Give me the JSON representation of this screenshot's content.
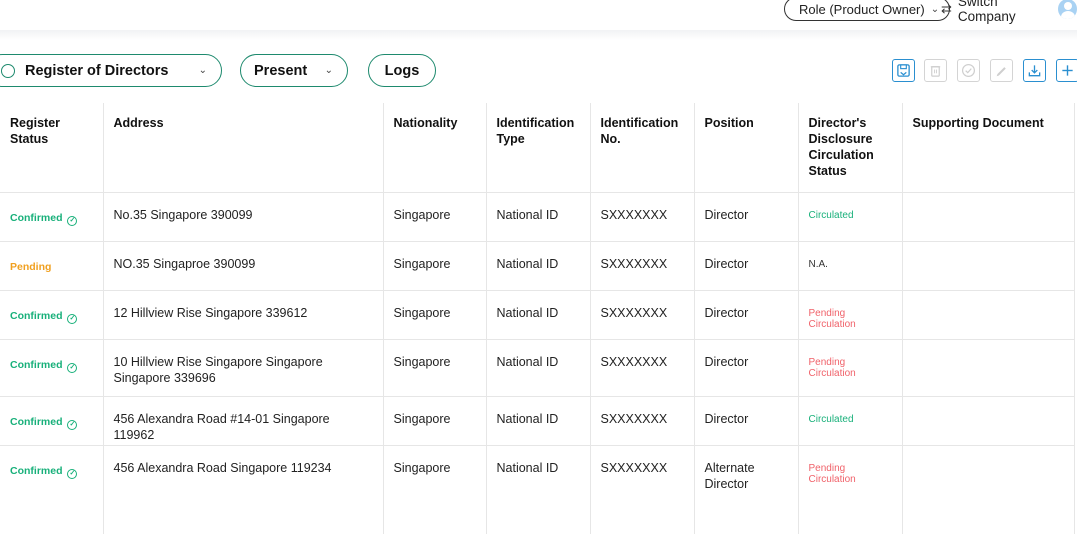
{
  "header": {
    "role_label": "Role (Product Owner)",
    "switch_label": "Switch Company"
  },
  "toolbar": {
    "register_select": "Register of Directors",
    "period_select": "Present",
    "logs_label": "Logs",
    "actions": [
      {
        "icon": "save-icon",
        "enabled": true
      },
      {
        "icon": "trash-icon",
        "enabled": false
      },
      {
        "icon": "check-circle-icon",
        "enabled": false
      },
      {
        "icon": "pencil-icon",
        "enabled": false
      },
      {
        "icon": "download-icon",
        "enabled": true
      },
      {
        "icon": "plus-icon",
        "enabled": true
      }
    ]
  },
  "table": {
    "headers": [
      "Register Status",
      "Address",
      "Nationality",
      "Identification Type",
      "Identification No.",
      "Position",
      "Director's Disclosure Circulation Status",
      "Supporting Document"
    ],
    "rows": [
      {
        "status": "Confirmed",
        "address": "No.35 Singapore 390099",
        "nationality": "Singapore",
        "id_type": "National ID",
        "id_no": "SXXXXXXX",
        "position": "Director",
        "circulation": "Circulated",
        "doc": ""
      },
      {
        "status": "Pending",
        "address": "NO.35 Singaproe 390099",
        "nationality": "Singapore",
        "id_type": "National ID",
        "id_no": "SXXXXXXX",
        "position": "Director",
        "circulation": "N.A.",
        "doc": ""
      },
      {
        "status": "Confirmed",
        "address": "12 Hillview Rise Singapore 339612",
        "nationality": "Singapore",
        "id_type": "National ID",
        "id_no": "SXXXXXXX",
        "position": "Director",
        "circulation": "Pending Circulation",
        "doc": ""
      },
      {
        "status": "Confirmed",
        "address": "10 Hillview Rise Singapore Singapore Singapore 339696",
        "nationality": "Singapore",
        "id_type": "National ID",
        "id_no": "SXXXXXXX",
        "position": "Director",
        "circulation": "Pending Circulation",
        "doc": ""
      },
      {
        "status": "Confirmed",
        "address": "456 Alexandra Road #14-01 Singapore 119962",
        "nationality": "Singapore",
        "id_type": "National ID",
        "id_no": "SXXXXXXX",
        "position": "Director",
        "circulation": "Circulated",
        "doc": ""
      },
      {
        "status": "Confirmed",
        "address": "456 Alexandra Road Singapore 119234",
        "nationality": "Singapore",
        "id_type": "National ID",
        "id_no": "SXXXXXXX",
        "position": "Alternate Director",
        "circulation": "Pending Circulation",
        "doc": ""
      }
    ]
  },
  "colors": {
    "accent": "#1e8a6e",
    "confirmed": "#18b07a",
    "pending": "#f0a020",
    "pending_circulation": "#f0626a",
    "action_blue": "#2a8fd0"
  }
}
